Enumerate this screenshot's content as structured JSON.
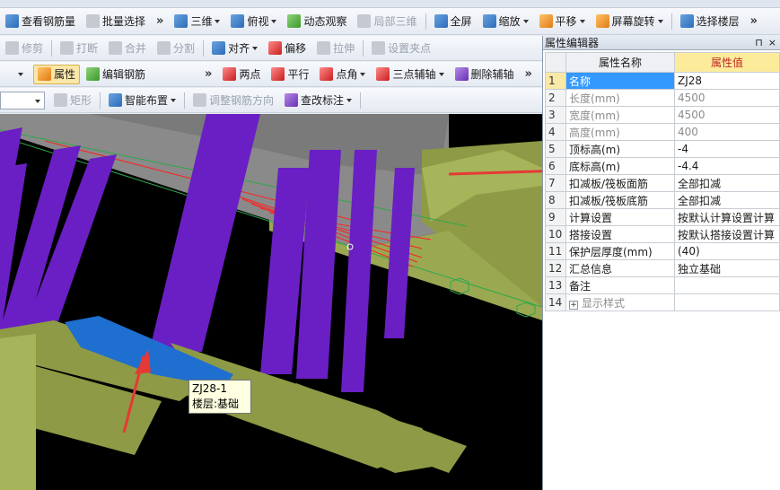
{
  "toolbar1": {
    "view_rebar": "查看钢筋量",
    "batch_select": "批量选择",
    "view_3d": "三维",
    "top_view": "俯视",
    "dynamic_view": "动态观察",
    "local_3d": "局部三维",
    "fullscreen": "全屏",
    "zoom": "缩放",
    "pan": "平移",
    "rotate": "屏幕旋转",
    "select_floor": "选择楼层",
    "more": "»"
  },
  "toolbar2": {
    "trim": "修剪",
    "break": "打断",
    "merge": "合并",
    "split": "分割",
    "align": "对齐",
    "offset": "偏移",
    "stretch": "拉伸",
    "set_grip": "设置夹点"
  },
  "toolbar3": {
    "properties": "属性",
    "edit_rebar": "编辑钢筋",
    "two_points": "两点",
    "parallel": "平行",
    "point_angle": "点角",
    "three_point_axis": "三点辅轴",
    "delete_axis": "删除辅轴",
    "more": "»"
  },
  "toolbar4": {
    "rectangle": "矩形",
    "smart_layout": "智能布置",
    "adjust_rebar_dir": "调整钢筋方向",
    "check_label": "查改标注"
  },
  "tooltip": {
    "line1": "ZJ28-1",
    "line2": "楼层:基础层"
  },
  "property_editor": {
    "title": "属性编辑器",
    "pin": "⊓",
    "close": "×",
    "header_name": "属性名称",
    "header_value": "属性值",
    "rows": [
      {
        "idx": "1",
        "name": "名称",
        "value": "ZJ28"
      },
      {
        "idx": "2",
        "name": "长度(mm)",
        "value": "4500"
      },
      {
        "idx": "3",
        "name": "宽度(mm)",
        "value": "4500"
      },
      {
        "idx": "4",
        "name": "高度(mm)",
        "value": "400"
      },
      {
        "idx": "5",
        "name": "顶标高(m)",
        "value": "-4"
      },
      {
        "idx": "6",
        "name": "底标高(m)",
        "value": "-4.4"
      },
      {
        "idx": "7",
        "name": "扣减板/筏板面筋",
        "value": "全部扣减"
      },
      {
        "idx": "8",
        "name": "扣减板/筏板底筋",
        "value": "全部扣减"
      },
      {
        "idx": "9",
        "name": "计算设置",
        "value": "按默认计算设置计算"
      },
      {
        "idx": "10",
        "name": "搭接设置",
        "value": "按默认搭接设置计算"
      },
      {
        "idx": "11",
        "name": "保护层厚度(mm)",
        "value": "(40)"
      },
      {
        "idx": "12",
        "name": "汇总信息",
        "value": "独立基础"
      },
      {
        "idx": "13",
        "name": "备注",
        "value": ""
      },
      {
        "idx": "14",
        "name": "显示样式",
        "value": "",
        "expandable": "+"
      }
    ]
  },
  "colors": {
    "column": "#6a1fc4",
    "slab": "#8c8c8c",
    "foundation": "#8e9a45",
    "selected": "#1f6fd0",
    "arrow": "#e53935"
  }
}
